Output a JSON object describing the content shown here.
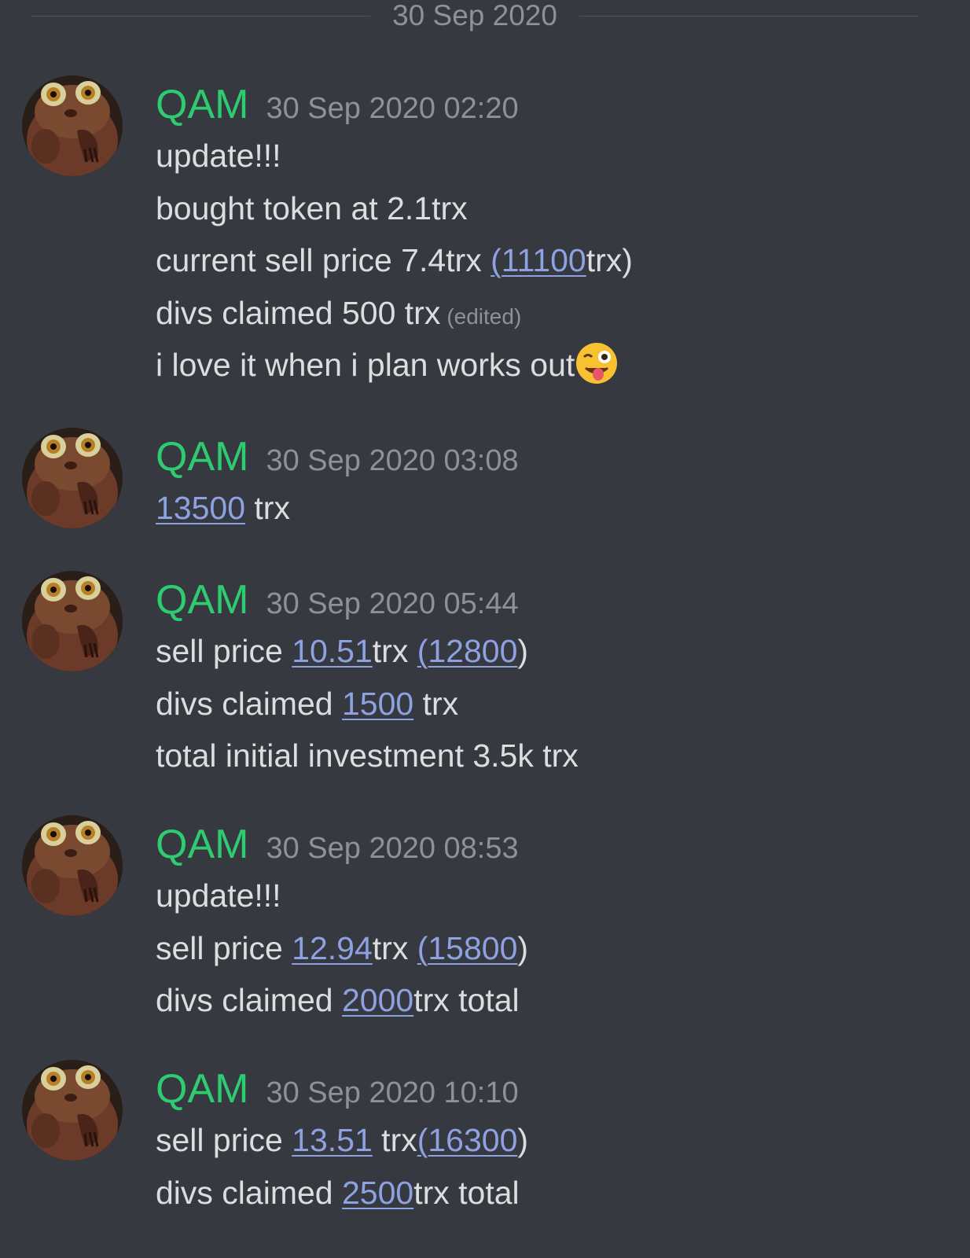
{
  "divider": {
    "date": "30 Sep 2020"
  },
  "messages": [
    {
      "username": "QAM",
      "timestamp": "30 Sep 2020 02:20",
      "lines": {
        "l1": "update!!!",
        "l2": "bought token at 2.1trx",
        "l3": {
          "a": "current sell price 7.4trx ",
          "link": "(11100",
          "b": "trx)"
        },
        "l4": {
          "a": "divs claimed 500 trx",
          "edited": "(edited)"
        },
        "l5": {
          "a": "i love it when i plan works out",
          "emoji": "winking-face-with-tongue-icon"
        }
      }
    },
    {
      "username": "QAM",
      "timestamp": "30 Sep 2020 03:08",
      "lines": {
        "l1": {
          "link": "13500",
          "b": " trx"
        }
      }
    },
    {
      "username": "QAM",
      "timestamp": "30 Sep 2020 05:44",
      "lines": {
        "l1": {
          "a": "sell price ",
          "link1": "10.51",
          "b": "trx ",
          "link2": "(12800",
          "c": ")"
        },
        "l2": {
          "a": "divs claimed ",
          "link": "1500",
          "b": " trx"
        },
        "l3": "total initial investment 3.5k trx"
      }
    },
    {
      "username": "QAM",
      "timestamp": "30 Sep 2020 08:53",
      "lines": {
        "l1": "update!!!",
        "l2": {
          "a": "sell price ",
          "link1": "12.94",
          "b": "trx ",
          "link2": "(15800",
          "c": ")"
        },
        "l3": {
          "a": "divs claimed ",
          "link": "2000",
          "b": "trx total"
        }
      }
    },
    {
      "username": "QAM",
      "timestamp": "30 Sep 2020 10:10",
      "lines": {
        "l1": {
          "a": "sell price ",
          "link1": "13.51",
          "b": " trx",
          "link2": "(16300",
          "c": ")"
        },
        "l2": {
          "a": "divs claimed ",
          "link": "2500",
          "b": "trx total"
        }
      }
    }
  ],
  "colors": {
    "background": "#36393f",
    "username": "#2ecc71",
    "timestamp": "#8e9297",
    "text": "#dcddde",
    "link": "#8ea1e1"
  }
}
